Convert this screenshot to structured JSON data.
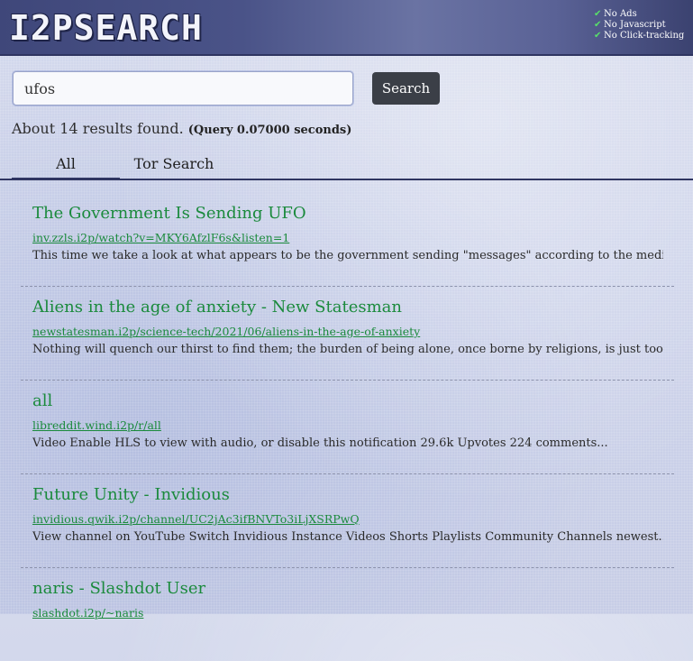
{
  "header": {
    "logo": "I2PSEARCH",
    "features": [
      "No Ads",
      "No Javascript",
      "No Click-tracking"
    ]
  },
  "search": {
    "value": "ufos",
    "button_label": "Search"
  },
  "stats": {
    "count_text": "About 14 results found.",
    "query_time": "(Query 0.07000 seconds)"
  },
  "tabs": [
    "All",
    "Tor Search"
  ],
  "results": [
    {
      "title": "The Government Is Sending UFO",
      "url": "inv.zzls.i2p/watch?v=MKY6AfzlF6s&listen=1",
      "snippet": "This time we take a look at what appears to be the government sending \"messages\" according to the media..."
    },
    {
      "title": "Aliens in the age of anxiety - New Statesman",
      "url": "newstatesman.i2p/science-tech/2021/06/aliens-in-the-age-of-anxiety",
      "snippet": "Nothing will quench our thirst to find them; the burden of being alone, once borne by religions, is just too..."
    },
    {
      "title": "all",
      "url": "libreddit.wind.i2p/r/all",
      "snippet": "Video Enable HLS to view with audio, or disable this notification 29.6k Upvotes 224 comments..."
    },
    {
      "title": "Future Unity - Invidious",
      "url": "invidious.qwik.i2p/channel/UC2jAc3ifBNVTo3iLjXSRPwQ",
      "snippet": "View channel on YouTube Switch Invidious Instance Videos Shorts Playlists Community Channels newest..."
    },
    {
      "title": "naris - Slashdot User",
      "url": "slashdot.i2p/~naris",
      "snippet": ""
    }
  ]
}
